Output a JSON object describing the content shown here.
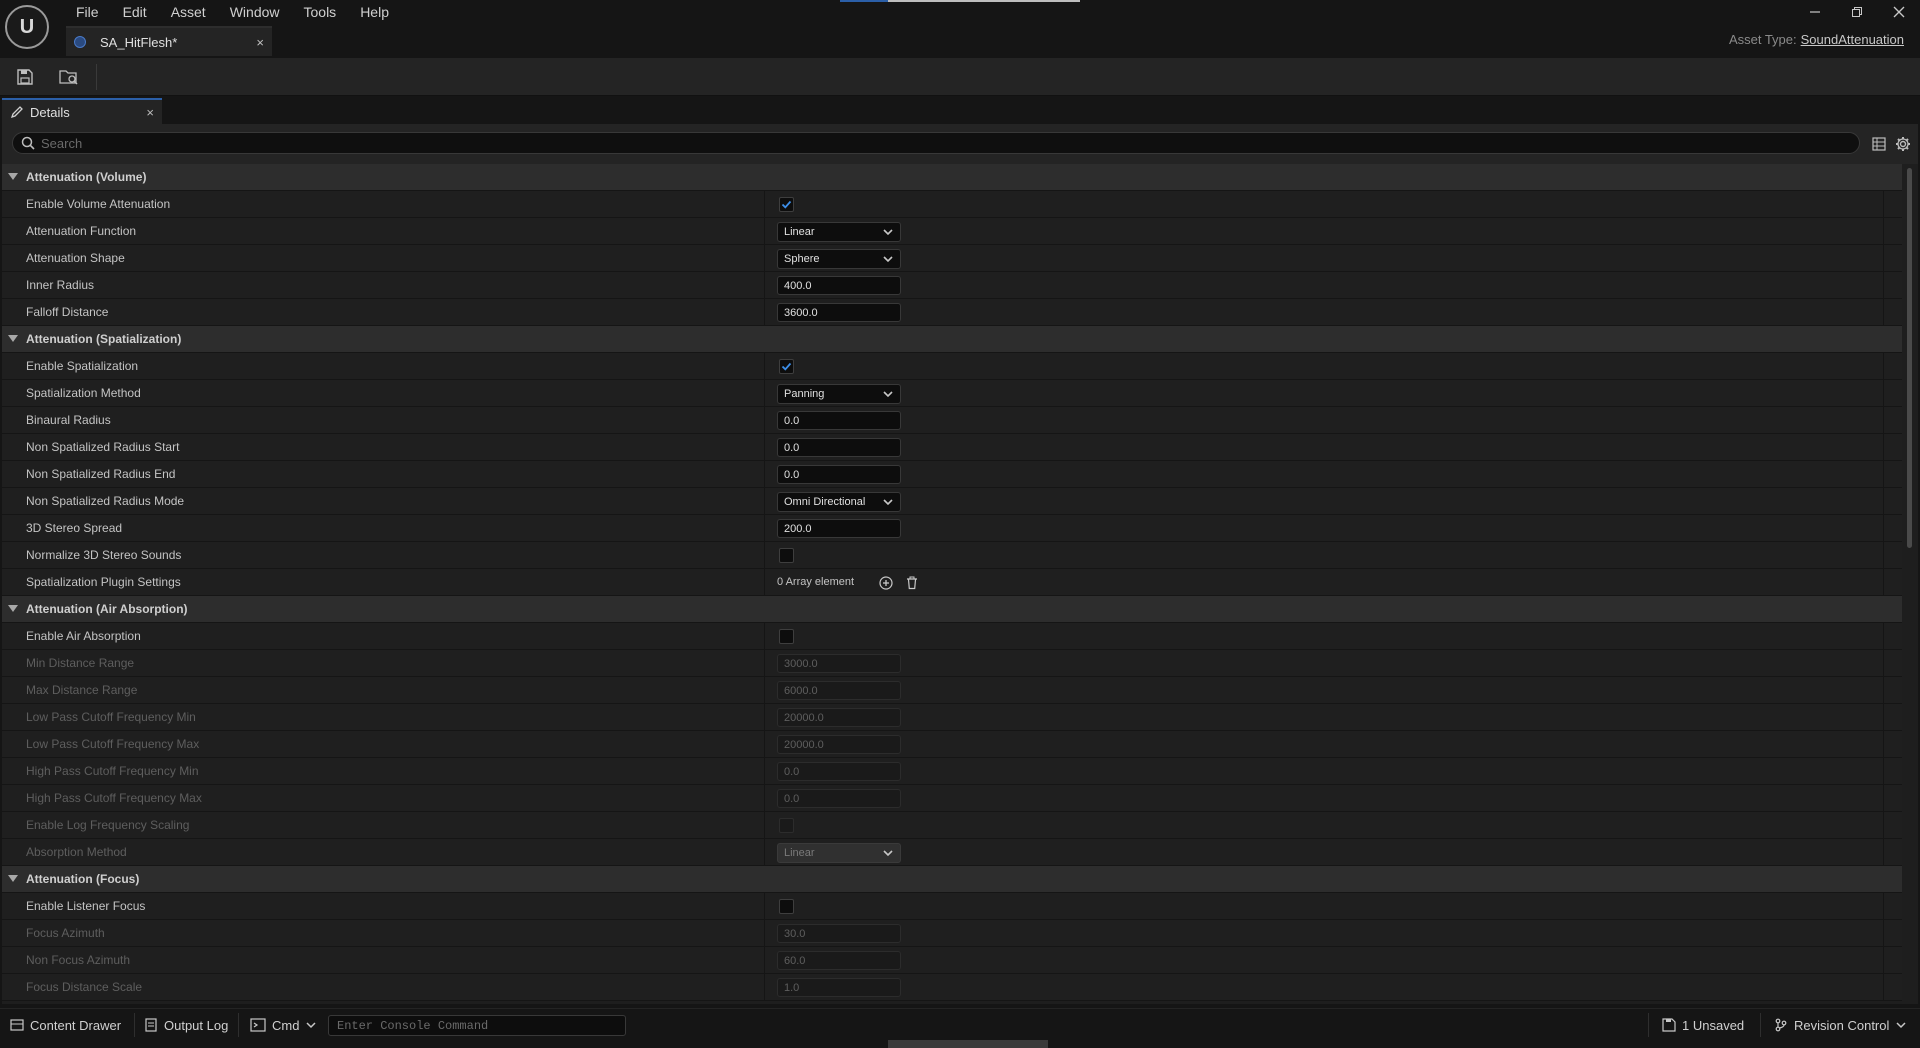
{
  "menu": [
    "File",
    "Edit",
    "Asset",
    "Window",
    "Tools",
    "Help"
  ],
  "logo": "U",
  "window_controls": {
    "minimize": "—",
    "restore": "❐",
    "close": "✕"
  },
  "doc_tab": {
    "label": "SA_HitFlesh*",
    "close": "×"
  },
  "asset_type": {
    "label": "Asset Type:",
    "value": "SoundAttenuation"
  },
  "toolbar": {
    "save_icon": "save-icon",
    "browse_icon": "browse-to-asset-icon"
  },
  "details_tab": {
    "label": "Details",
    "close": "×"
  },
  "search": {
    "placeholder": "Search",
    "value": ""
  },
  "categories": [
    {
      "name": "Attenuation (Volume)",
      "props": [
        {
          "label": "Enable Volume Attenuation",
          "type": "checkbox",
          "checked": true,
          "disabled": false
        },
        {
          "label": "Attenuation Function",
          "type": "dropdown",
          "value": "Linear",
          "disabled": false
        },
        {
          "label": "Attenuation Shape",
          "type": "dropdown",
          "value": "Sphere",
          "disabled": false
        },
        {
          "label": "Inner Radius",
          "type": "number",
          "value": "400.0",
          "disabled": false
        },
        {
          "label": "Falloff Distance",
          "type": "number",
          "value": "3600.0",
          "disabled": false
        }
      ]
    },
    {
      "name": "Attenuation (Spatialization)",
      "props": [
        {
          "label": "Enable Spatialization",
          "type": "checkbox",
          "checked": true,
          "disabled": false
        },
        {
          "label": "Spatialization Method",
          "type": "dropdown",
          "value": "Panning",
          "disabled": false
        },
        {
          "label": "Binaural Radius",
          "type": "number",
          "value": "0.0",
          "disabled": false
        },
        {
          "label": "Non Spatialized Radius Start",
          "type": "number",
          "value": "0.0",
          "disabled": false
        },
        {
          "label": "Non Spatialized Radius End",
          "type": "number",
          "value": "0.0",
          "disabled": false
        },
        {
          "label": "Non Spatialized Radius Mode",
          "type": "dropdown",
          "value": "Omni Directional",
          "disabled": false
        },
        {
          "label": "3D Stereo Spread",
          "type": "number",
          "value": "200.0",
          "disabled": false
        },
        {
          "label": "Normalize 3D Stereo Sounds",
          "type": "checkbox",
          "checked": false,
          "disabled": false
        },
        {
          "label": "Spatialization Plugin Settings",
          "type": "array",
          "value": "0 Array element",
          "disabled": false
        }
      ]
    },
    {
      "name": "Attenuation (Air Absorption)",
      "props": [
        {
          "label": "Enable Air Absorption",
          "type": "checkbox",
          "checked": false,
          "disabled": false
        },
        {
          "label": "Min Distance Range",
          "type": "number",
          "value": "3000.0",
          "disabled": true
        },
        {
          "label": "Max Distance Range",
          "type": "number",
          "value": "6000.0",
          "disabled": true
        },
        {
          "label": "Low Pass Cutoff Frequency Min",
          "type": "number",
          "value": "20000.0",
          "disabled": true
        },
        {
          "label": "Low Pass Cutoff Frequency Max",
          "type": "number",
          "value": "20000.0",
          "disabled": true
        },
        {
          "label": "High Pass Cutoff Frequency Min",
          "type": "number",
          "value": "0.0",
          "disabled": true
        },
        {
          "label": "High Pass Cutoff Frequency Max",
          "type": "number",
          "value": "0.0",
          "disabled": true
        },
        {
          "label": "Enable Log Frequency Scaling",
          "type": "checkbox",
          "checked": false,
          "disabled": true
        },
        {
          "label": "Absorption Method",
          "type": "dropdown",
          "value": "Linear",
          "disabled": true
        }
      ]
    },
    {
      "name": "Attenuation (Focus)",
      "props": [
        {
          "label": "Enable Listener Focus",
          "type": "checkbox",
          "checked": false,
          "disabled": false
        },
        {
          "label": "Focus Azimuth",
          "type": "number",
          "value": "30.0",
          "disabled": true
        },
        {
          "label": "Non Focus Azimuth",
          "type": "number",
          "value": "60.0",
          "disabled": true
        },
        {
          "label": "Focus Distance Scale",
          "type": "number",
          "value": "1.0",
          "disabled": true
        }
      ]
    }
  ],
  "statusbar": {
    "content_drawer": "Content Drawer",
    "output_log": "Output Log",
    "cmd": "Cmd",
    "console_placeholder": "Enter Console Command",
    "unsaved": "1 Unsaved",
    "revision_control": "Revision Control"
  }
}
